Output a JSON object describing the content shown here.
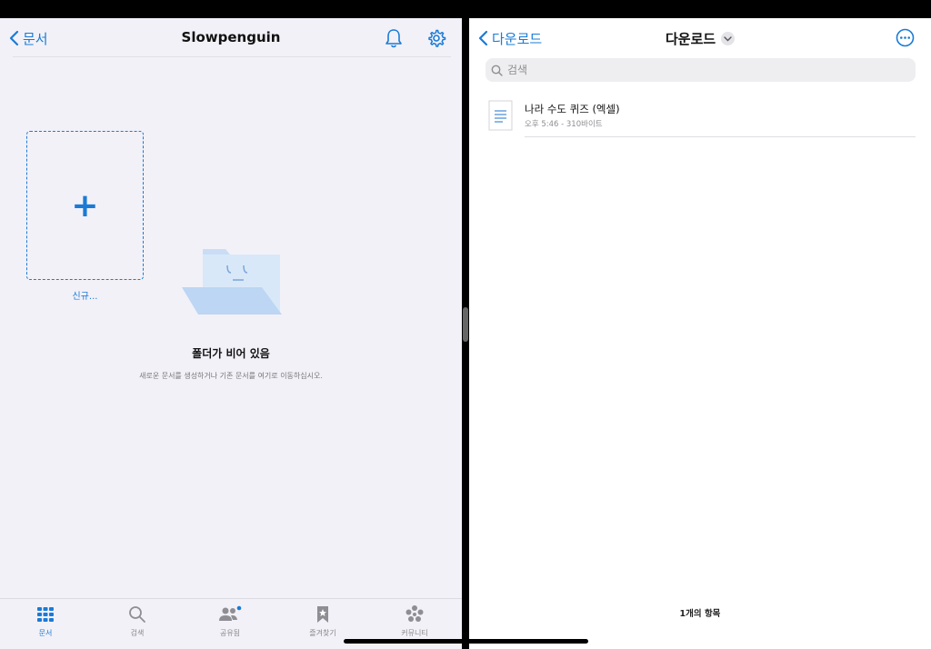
{
  "left": {
    "back_label": "문서",
    "title": "Slowpenguin",
    "new_label": "신규...",
    "empty_title": "폴더가 비어 있음",
    "empty_desc": "새로운 문서를 생성하거나 기존 문서를 여기로 이동하십시오.",
    "tabs": [
      {
        "label": "문서",
        "icon": "grid-icon",
        "active": true
      },
      {
        "label": "검색",
        "icon": "search-icon"
      },
      {
        "label": "공유됨",
        "icon": "people-icon"
      },
      {
        "label": "즐겨찾기",
        "icon": "bookmark-star-icon"
      },
      {
        "label": "커뮤니티",
        "icon": "community-icon"
      }
    ]
  },
  "right": {
    "back_label": "다운로드",
    "title": "다운로드",
    "search_placeholder": "검색",
    "files": [
      {
        "name": "나라 수도 퀴즈 (엑셀)",
        "meta": "오후 5:46 - 310바이트",
        "icon": "document-icon"
      }
    ],
    "item_count": "1개의 항목"
  },
  "colors": {
    "accent": "#1a7bd6",
    "left_bg": "#f2f1f8",
    "right_bg": "#ffffff"
  }
}
